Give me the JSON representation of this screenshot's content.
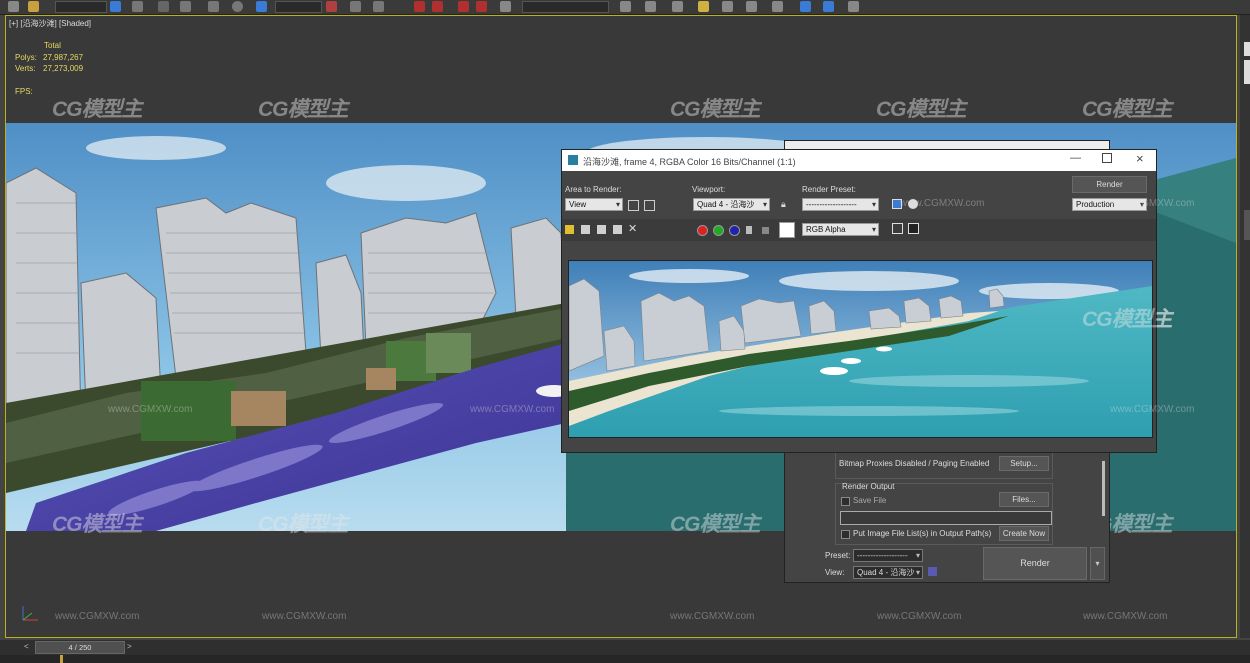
{
  "viewport": {
    "label": "[+] [沿海沙滩] [Shaded]",
    "stats": {
      "total_label": "Total",
      "polys_label": "Polys:",
      "polys_value": "27,987,267",
      "verts_label": "Verts:",
      "verts_value": "27,273,009",
      "fps_label": "FPS:"
    }
  },
  "watermark": {
    "logo": "CG模型主",
    "url": "www.CGMXW.com"
  },
  "frame_window": {
    "title": "沿海沙滩, frame 4, RGBA Color 16 Bits/Channel (1:1)",
    "area_to_render_label": "Area to Render:",
    "area_to_render_value": "View",
    "viewport_label": "Viewport:",
    "viewport_value": "Quad 4 - 沿海沙",
    "render_preset_label": "Render Preset:",
    "render_preset_value": "-------------------",
    "render_button": "Render",
    "production_value": "Production",
    "channel_value": "RGB Alpha"
  },
  "render_setup": {
    "bitmap_proxies_text": "Bitmap Proxies Disabled / Paging Enabled",
    "setup_button": "Setup...",
    "render_output_label": "Render Output",
    "save_file_label": "Save File",
    "files_button": "Files...",
    "put_image_label": "Put Image File List(s) in Output Path(s)",
    "create_now_button": "Create Now",
    "preset_label": "Preset:",
    "preset_value": "-------------------",
    "view_label": "View:",
    "view_value": "Quad 4 - 沿海沙",
    "render_button": "Render"
  },
  "timeline": {
    "frame_text": "4 / 250"
  },
  "colors": {
    "viewport_border": "#b9b21a",
    "stats_text": "#e7d960",
    "panel_bg": "#444444"
  }
}
